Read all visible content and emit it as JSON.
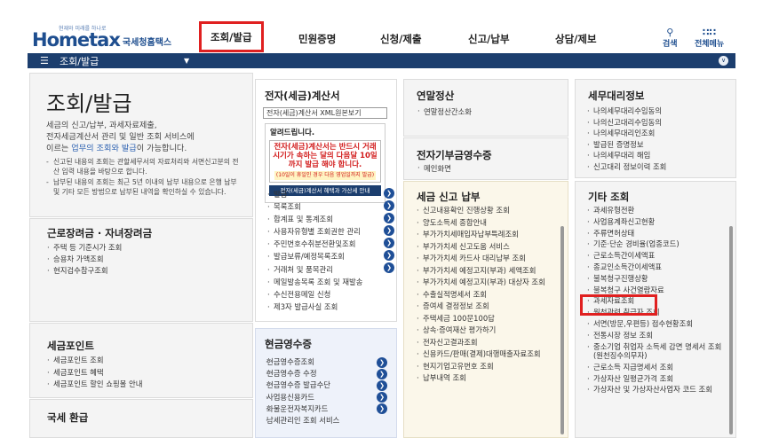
{
  "header": {
    "logo_text": "Hometax",
    "logo_tagline": "현재와 미래를 하나로",
    "logo_subtitle": "국세청홈택스",
    "nav": [
      "조회/발급",
      "민원증명",
      "신청/제출",
      "신고/납부",
      "상담/제보"
    ],
    "search_label": "검색",
    "allmenu_label": "전체메뉴"
  },
  "bar": {
    "title": "조회/발급"
  },
  "intro": {
    "title": "조회/발급",
    "desc_1": "세금의 신고/납부, 과세자료제출,",
    "desc_2": "전자세금계산서 관리 및 일반 조회 서비스에",
    "desc_3_pre": "이르는 ",
    "desc_3_hl": "업무의 조회와 발급",
    "desc_3_post": "이 가능합니다.",
    "notes": [
      "신고된 내용의 조회는 관할세무서의 자료처리와 서면신고분의 전산 입력 내용을 바탕으로 합니다.",
      "납부된 내용의 조회는 최근 5년 이내의 납부 내용으로 은행 납부 및 기타 모든 방법으로 납부된 내역을 확인하실 수 있습니다."
    ]
  },
  "earned_credit": {
    "title": "근로장려금 · 자녀장려금",
    "items": [
      "주택 등 기준시가 조회",
      "승용차 가액조회",
      "현지검수참구조회"
    ]
  },
  "tax_point": {
    "title": "세금포인트",
    "items": [
      "세금포인트 조회",
      "세금포인트 혜택",
      "세금포인트 할인 쇼핑몰 안내"
    ]
  },
  "refund": {
    "title": "국세 환급"
  },
  "e_invoice": {
    "title": "전자(세금)계산서",
    "button": "전자(세금)계산서 XML원본보기",
    "notice_title": "알려드립니다.",
    "notice_text": "전자(세금)계산서는 반드시 거래시기가 속하는 달의 다음달 10일까지 발급 해야 합니다.",
    "notice_badge": "(10일이 휴일인 경우 다음 영업일까지 발급)",
    "notice_strip": "전자(세금)계산서 혜택과 가산세 안내",
    "items": [
      "발급",
      "목록조회",
      "합계표 및 통계조회",
      "사용자유형별 조회권한 관리",
      "주민번호수취분전환및조회",
      "발급보류/예정목록조회",
      "거래처 및 품목관리",
      "메일발송목록 조회 및 재발송",
      "수신전용메일 신청",
      "제3자 발급사실 조회"
    ]
  },
  "cash_receipt": {
    "title": "현금영수증",
    "items": [
      "현금영수증조회",
      "현금영수증 수정",
      "현금영수증 발급수단",
      "사업용신용카드",
      "화물운전자복지카드",
      "남세관리인 조회 서비스"
    ]
  },
  "year_end": {
    "title": "연말정산",
    "items": [
      "연말정산간소화"
    ]
  },
  "e_bill": {
    "title": "전자기부금영수증",
    "items": [
      "메인화면"
    ]
  },
  "tax_filing": {
    "title": "세금 신고 납부",
    "items": [
      "신고내용확인 진행상황 조회",
      "양도소득세 종합안내",
      "부가가치세매입자납부특례조회",
      "부가가치세 신고도움 서비스",
      "부가가치세 카드사 대리납부 조회",
      "부가가치세 예정고지(부과) 세액조회",
      "부가가치세 예정고지(부과) 대상자 조회",
      "수출실적명세서 조회",
      "증여세 결정정보 조회",
      "주택세금 100문100답",
      "상속·증여재산 평가하기",
      "전자신고결과조회",
      "신용카드/판매(결제)대행매출자료조회",
      "현지기업고유번호 조회",
      "납부내역 조회"
    ]
  },
  "agent": {
    "title": "세무대리정보",
    "items": [
      "나의세무대리수임동의",
      "나의신고대리수임동의",
      "나의세무대리인조회",
      "발급된 증명정보",
      "나의세무대리 해임",
      "신고대리 정보이력 조회"
    ]
  },
  "other": {
    "title": "기타 조회",
    "items": [
      "과세유형전환",
      "사업용계좌신고현황",
      "주류면허상태",
      "기준·단순 경비율(업종코드)",
      "근로소득간이세액표",
      "종교인소득간이세액표",
      "불복청구진행상황",
      "불복청구 사건열람자료",
      "과세자료조회",
      "원천관련 취급자 조회",
      "서면(방문,우편등) 접수현황조회",
      "전통시장 정보 조회",
      "중소기업 취업자 소득세 감면 명세서 조회(원천징수의무자)",
      "근로소득 지급명세서 조회",
      "가상자산 일평균가격 조회",
      "가상자산 및 가상자산사업자 코드 조회"
    ]
  },
  "colors": {
    "brand": "#1e4e8f",
    "bar": "#1c3e6e",
    "highlight": "#e02020",
    "arrow": "#1f4f97"
  }
}
